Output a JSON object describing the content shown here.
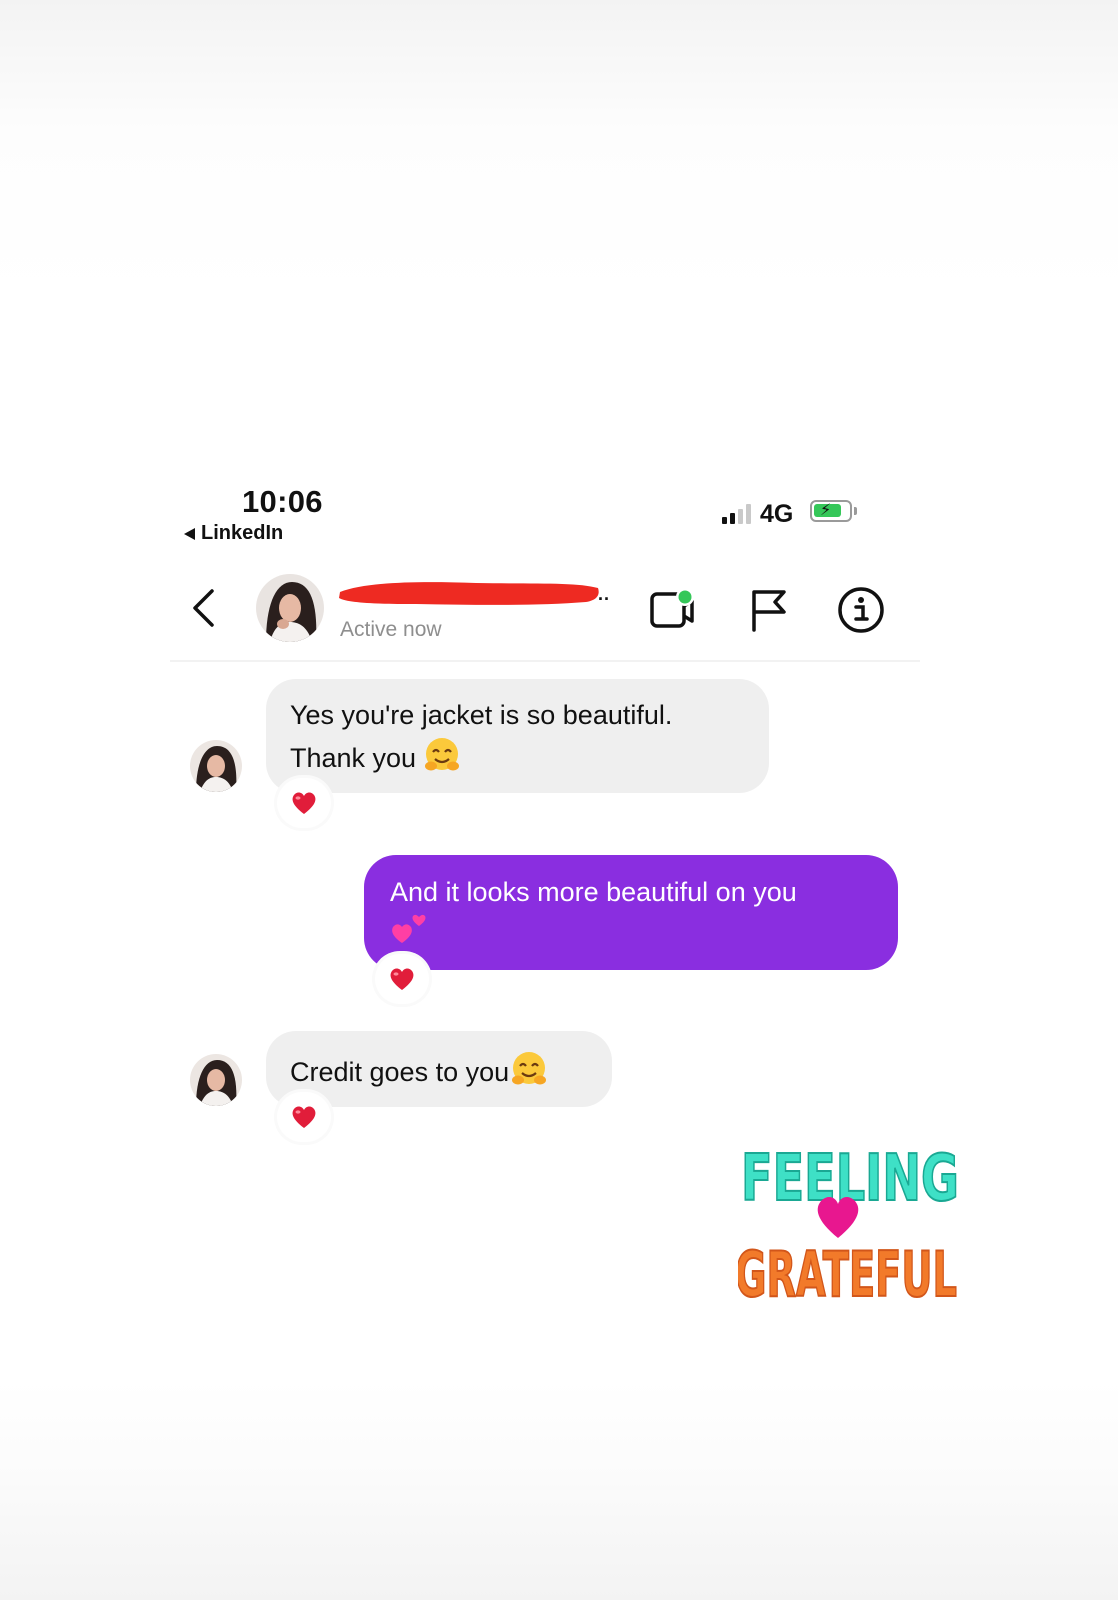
{
  "status_bar": {
    "time": "10:06",
    "back_app": "LinkedIn",
    "network": "4G",
    "signal_bars_active": 2,
    "signal_bars_total": 4,
    "battery_charging": true,
    "battery_level": 0.7
  },
  "header": {
    "contact_name_redacted": true,
    "status": "Active now",
    "icons": [
      "back-chevron-icon",
      "video-call-icon",
      "flag-icon",
      "info-icon"
    ]
  },
  "messages": [
    {
      "direction": "incoming",
      "lines": [
        "Yes you're jacket is so beautiful.",
        "Thank you"
      ],
      "emoji": "smiling-hug-emoji",
      "reaction": "heart"
    },
    {
      "direction": "outgoing",
      "lines": [
        "And it looks more beautiful on you"
      ],
      "emoji": "two-hearts-emoji",
      "reaction": "heart"
    },
    {
      "direction": "incoming",
      "lines": [
        "Credit goes to you"
      ],
      "emoji": "smiling-hug-emoji",
      "reaction": "heart"
    }
  ],
  "sticker": {
    "line1": "FEELING",
    "line2": "GRATEFUL",
    "colors": {
      "top": "#3ee0c6",
      "heart": "#e8178f",
      "bottom": "#f27a2a"
    }
  },
  "colors": {
    "outgoing_bubble": "#8a2ee0",
    "incoming_bubble": "#efefef",
    "active_dot": "#35c759",
    "redaction": "#ee2a22"
  }
}
